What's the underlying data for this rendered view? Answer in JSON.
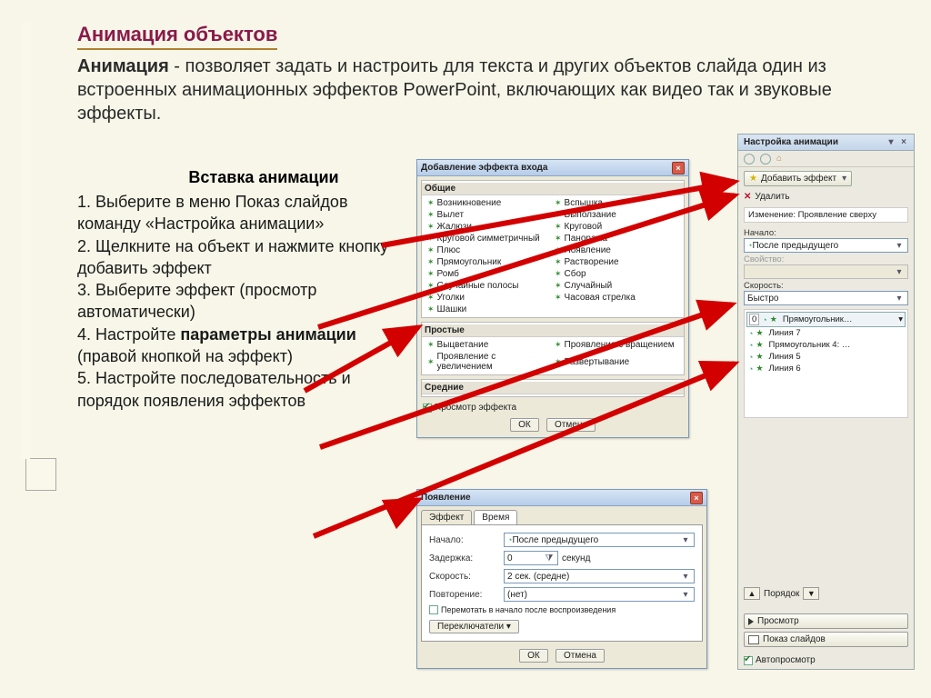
{
  "title": "Анимация объектов",
  "intro_bold": "Анимация",
  "intro_rest": " - позволяет задать и настроить для текста и других объектов слайда один из встроенных анимационных эффектов PowerPoint, включающих как видео так и звуковые эффекты.",
  "subhead": "Вставка анимации",
  "steps_html": "1. Выберите в меню Показ слайдов команду «Настройка анимации»\n2. Щелкните на объект и нажмите кнопку добавить эффект\n3. Выберите эффект (просмотр автоматически)\n4. Настройте <b>параметры анимации</b> (правой кнопкой на эффект)\n5. Настройте последовательность и порядок появления эффектов",
  "dlg_add": {
    "title": "Добавление эффекта входа",
    "group1": "Общие",
    "effects_col1": [
      "Возникновение",
      "Вылет",
      "Жалюзи",
      "Круговой симметричный",
      "Плюс",
      "Прямоугольник",
      "Ромб",
      "Случайные полосы",
      "Уголки",
      "Шашки"
    ],
    "effects_col2": [
      "Вспышка",
      "Выползание",
      "Круговой",
      "Панорама",
      "Появление",
      "Растворение",
      "Сбор",
      "Случайный",
      "Часовая стрелка",
      ""
    ],
    "group2": "Простые",
    "simple_col1": [
      "Выцветание",
      "Проявление с увеличением"
    ],
    "simple_col2": [
      "Проявление с вращением",
      "Развертывание"
    ],
    "group3": "Средние",
    "preview_chk": "Просмотр эффекта",
    "ok": "ОК",
    "cancel": "Отмена"
  },
  "dlg_time": {
    "title": "Появление",
    "tab_effect": "Эффект",
    "tab_time": "Время",
    "start_lbl": "Начало:",
    "start_val": "После предыдущего",
    "delay_lbl": "Задержка:",
    "delay_val": "0",
    "delay_unit": "секунд",
    "speed_lbl": "Скорость:",
    "speed_val": "2 сек. (средне)",
    "repeat_lbl": "Повторение:",
    "repeat_val": "(нет)",
    "rewind_lbl": "Перемотать в начало после воспроизведения",
    "triggers": "Переключатели ▾",
    "ok": "ОК",
    "cancel": "Отмена"
  },
  "pane": {
    "title": "Настройка анимации",
    "add_btn": "Добавить эффект",
    "delete": "Удалить",
    "changeline": "Изменение: Проявление сверху",
    "start_lbl": "Начало:",
    "start_val": "После предыдущего",
    "prop_lbl": "Свойство:",
    "speed_lbl": "Скорость:",
    "speed_val": "Быстро",
    "list": [
      "Прямоугольник…",
      "Линия 7",
      "Прямоугольник 4: …",
      "Линия 5",
      "Линия 6"
    ],
    "order": "Порядок",
    "play": "Просмотр",
    "slideshow": "Показ слайдов",
    "autopreview": "Автопросмотр"
  }
}
